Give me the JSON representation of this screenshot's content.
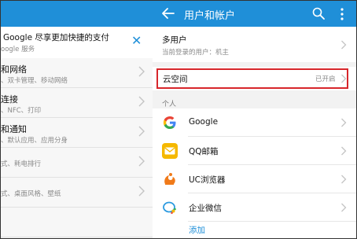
{
  "left_pane": {
    "banner": {
      "title": "Google 尽享更加快捷的支付",
      "subtitle": "oogle 服务",
      "close_glyph": "✕"
    },
    "rows": [
      {
        "title": "和网络",
        "subtitle": "、双卡管理、移动网络"
      },
      {
        "title": "连接",
        "subtitle": "、NFC、打印"
      },
      {
        "title": "和通知",
        "subtitle": "、默认应用、应用分身"
      },
      {
        "title": "",
        "subtitle": "式、耗电排行"
      },
      {
        "title": "",
        "subtitle": "式、桌面风格、壁纸"
      },
      {
        "title": "",
        "subtitle": ""
      }
    ]
  },
  "app_bar": {
    "title": "用户和帐户",
    "accent_color": "#1f8fd8"
  },
  "multi_user": {
    "title": "多用户",
    "subtitle": "当前登录的用户：机主"
  },
  "cloud": {
    "title": "云空间",
    "status": "已开启",
    "highlight_color": "#d7262b"
  },
  "section_title": "个人",
  "accounts": [
    {
      "label": "Google",
      "icon": "google-icon"
    },
    {
      "label": "QQ邮箱",
      "icon": "qq-mail-icon"
    },
    {
      "label": "UC浏览器",
      "icon": "uc-browser-icon"
    },
    {
      "label": "企业微信",
      "icon": "wework-icon"
    }
  ],
  "add_label": "添加"
}
